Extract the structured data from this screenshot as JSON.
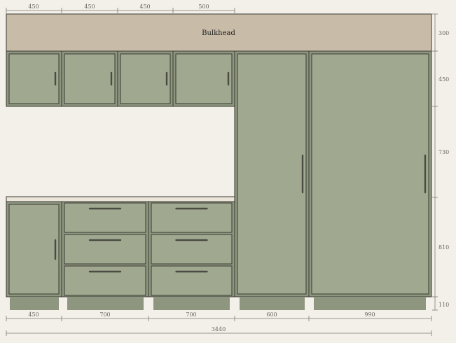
{
  "colors": {
    "background": "#f3f0ea",
    "bulkhead": "#c8bca8",
    "cabinet": "#a0a890",
    "carcass": "#8e967f",
    "line": "#3a3a32",
    "handle": "#4a4c42",
    "kickboard": "#8e967f",
    "dim_line": "#7c7870",
    "dim_text": "#6a665e"
  },
  "bulkhead": {
    "label": "Bulkhead"
  },
  "dimensions": {
    "top": [
      "450",
      "450",
      "450",
      "500"
    ],
    "right": [
      "300",
      "450",
      "730",
      "810",
      "110"
    ],
    "bottom": [
      "450",
      "700",
      "700",
      "600",
      "990"
    ],
    "total": "3440"
  },
  "upper_cabinets": [
    {
      "name": "upper-cabinet-1",
      "width": "450",
      "handle": "right"
    },
    {
      "name": "upper-cabinet-2",
      "width": "450",
      "handle": "right"
    },
    {
      "name": "upper-cabinet-3",
      "width": "450",
      "handle": "right"
    },
    {
      "name": "upper-cabinet-4",
      "width": "500",
      "handle": "right"
    }
  ],
  "base_units": [
    {
      "name": "base-door-cabinet",
      "type": "door",
      "width": "450"
    },
    {
      "name": "drawer-stack-1",
      "type": "drawers",
      "drawers": 3,
      "width": "700"
    },
    {
      "name": "drawer-stack-2",
      "type": "drawers",
      "drawers": 3,
      "width": "700"
    }
  ],
  "tall_cabinets": [
    {
      "name": "tall-cabinet-600",
      "width": "600"
    },
    {
      "name": "tall-cabinet-990",
      "width": "990"
    }
  ]
}
